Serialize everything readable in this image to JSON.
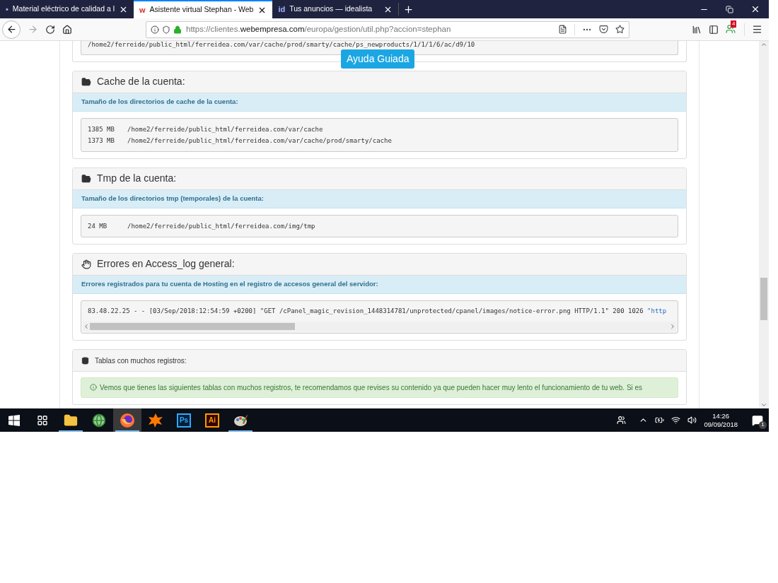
{
  "tabs": [
    {
      "title": "Material eléctrico de calidad a l",
      "favicon": "•",
      "selected": false
    },
    {
      "title": "Asistente virtual Stephan - Web",
      "favicon": "w",
      "selected": true
    },
    {
      "title": "Tus anuncios — idealista",
      "favicon": "id",
      "selected": false
    }
  ],
  "url": {
    "prefix": "https://clientes.",
    "domain": "webempresa.com",
    "path": "/europa/gestion/util.php?accion=stephan"
  },
  "notification_badge": "4",
  "help_button": "Ayuda Guiada",
  "top_code": "/home2/ferreide/public_html/ferreidea.com/var/cache/prod/smarty/cache/ps_newproducts/1/1/1/6/ac/d9/10",
  "panels": [
    {
      "kind": "folder",
      "title": "Cache de la cuenta:",
      "subtitle": "Tamaño de los directorios de cache de la cuenta:",
      "lines": [
        {
          "size": "1385 MB",
          "path": "/home2/ferreide/public_html/ferreidea.com/var/cache"
        },
        {
          "size": "1373 MB",
          "path": "/home2/ferreide/public_html/ferreidea.com/var/cache/prod/smarty/cache"
        }
      ]
    },
    {
      "kind": "folder",
      "title": "Tmp de la cuenta:",
      "subtitle": "Tamaño de los directorios tmp (temporales) de la cuenta:",
      "lines": [
        {
          "size": "24 MB",
          "path": "/home2/ferreide/public_html/ferreidea.com/img/tmp"
        }
      ]
    },
    {
      "kind": "log",
      "title": "Errores en Access_log general:",
      "subtitle": "Errores registrados para tu cuenta de Hosting en el registro de accesos general del servidor:",
      "log": "83.48.22.25 - - [03/Sep/2018:12:54:59 +0200] \"GET /cPanel_magic_revision_1448314781/unprotected/cpanel/images/notice-error.png HTTP/1.1\" 200 1026 ",
      "log_link": "\"http"
    },
    {
      "kind": "tables",
      "title": "Tablas con muchos registros:",
      "alert": "Vemos que tienes las siguientes tablas con muchos registros, te recomendamos que revises su contenido ya que pueden hacer muy lento el funcionamiento de tu web. Si es"
    }
  ],
  "taskbar": [
    {
      "kind": "windows",
      "running": false,
      "selected": false
    },
    {
      "kind": "taskview",
      "running": false,
      "selected": false
    },
    {
      "kind": "explorer",
      "running": true,
      "selected": false
    },
    {
      "kind": "globe",
      "running": false,
      "selected": false
    },
    {
      "kind": "firefox",
      "running": true,
      "selected": true
    },
    {
      "kind": "avast",
      "running": false,
      "selected": false
    },
    {
      "kind": "ps",
      "label": "Ps",
      "running": false,
      "selected": false
    },
    {
      "kind": "ai",
      "label": "Ai",
      "running": false,
      "selected": false
    },
    {
      "kind": "palette",
      "running": true,
      "selected": false
    }
  ],
  "clock": {
    "time": "14:26",
    "date": "09/09/2018"
  },
  "notifications_count": "1"
}
